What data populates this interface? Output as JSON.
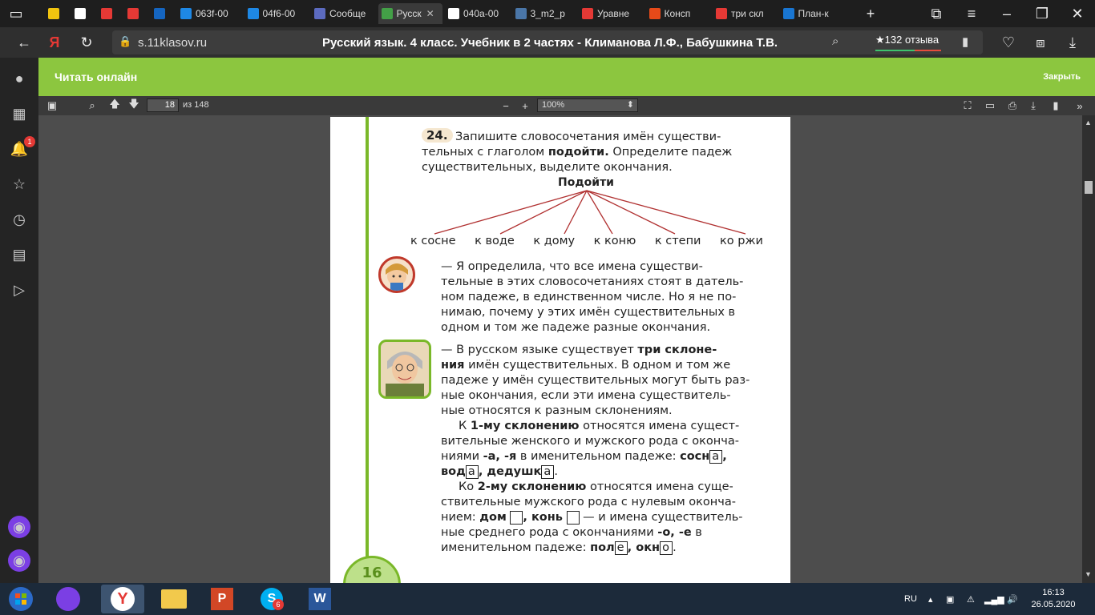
{
  "browser": {
    "tabs": [
      {
        "label": "",
        "color": "#f1c40f",
        "icon": "yellow-i-icon"
      },
      {
        "label": "",
        "color": "#ffffff",
        "icon": "doc-icon"
      },
      {
        "label": "",
        "color": "#e53935",
        "icon": "pdf-icon"
      },
      {
        "label": "",
        "color": "#e53935",
        "icon": "pdf-icon"
      },
      {
        "label": "",
        "color": "#1565c0",
        "icon": "mail-icon"
      },
      {
        "label": "063f-00",
        "color": "#1e88e5",
        "icon": "file-icon"
      },
      {
        "label": "04f6-00",
        "color": "#1e88e5",
        "icon": "file-icon"
      },
      {
        "label": "Сообще",
        "color": "#5c6bc0",
        "icon": "chat-icon"
      },
      {
        "label": "Русск",
        "color": "#43a047",
        "icon": "book-icon"
      },
      {
        "label": "040a-00",
        "color": "#ffffff",
        "icon": "doc-icon"
      },
      {
        "label": "3_m2_p",
        "color": "#4a76a8",
        "icon": "vk-icon"
      },
      {
        "label": "Уравне",
        "color": "#e53935",
        "icon": "yandex-icon"
      },
      {
        "label": "Консп",
        "color": "#e64a19",
        "icon": "briefcase-icon"
      },
      {
        "label": "три скл",
        "color": "#e53935",
        "icon": "yandex-icon"
      },
      {
        "label": "План-к",
        "color": "#1976d2",
        "icon": "check-icon"
      }
    ],
    "url_domain": "s.11klasov.ru",
    "page_title": "Русский язык. 4 класс. Учебник в 2 частях - Климанова Л.Ф., Бабушкина Т.В.",
    "reviews": "★132 отзыва"
  },
  "reader": {
    "title": "Читать онлайн",
    "close": "Закрыть",
    "page_current": "18",
    "page_total": "из 148",
    "zoom": "100%",
    "zoom_minus": "−",
    "zoom_plus": "+"
  },
  "book": {
    "exercise_number": "24.",
    "task_line1": "Запишите словосочетания имён существи-",
    "task_line2a": "тельных с глаголом ",
    "task_line2b": "подойти.",
    "task_line2c": " Определите падеж",
    "task_line3": "существительных, выделите окончания.",
    "verb": "Подойти",
    "words": [
      "к сосне",
      "к воде",
      "к дому",
      "к коню",
      "к степи",
      "ко ржи"
    ],
    "girl_text": [
      "— Я определила, что все имена существи-",
      "тельные в этих словосочетаниях стоят в датель-",
      "ном падеже, в единственном числе. Но я не по-",
      "нимаю, почему у этих имён существительных в",
      "одном и том же падеже разные окончания."
    ],
    "grandpa_l1a": "— В русском языке существует ",
    "grandpa_l1b": "три склоне-",
    "grandpa_l2a": "ния",
    "grandpa_l2b": " имён существительных. В одном и том же",
    "grandpa_l3": "падеже у имён существительных могут быть раз-",
    "grandpa_l4": "ные окончания, если эти имена существитель-",
    "grandpa_l5": "ные относятся к разным склонениям.",
    "decl1_l1a": "К ",
    "decl1_l1b": "1-му склонению",
    "decl1_l1c": " относятся имена сущест-",
    "decl1_l2": "вительные женского и мужского рода с оконча-",
    "decl1_l3a": "ниями ",
    "decl1_l3b": "-а, -я",
    "decl1_l3c": " в именительном падеже: ",
    "w_sosn": "сосн",
    "w_vod": "вод",
    "w_dedushk": "дедушк",
    "end_a": "а",
    "decl2_l1a": "Ко ",
    "decl2_l1b": "2-му склонению",
    "decl2_l1c": " относятся имена суще-",
    "decl2_l2": "ствительные мужского рода с нулевым оконча-",
    "decl2_l3a": "нием: ",
    "w_dom": "дом",
    "w_kon": "конь",
    "decl2_l3b": " — и имена существитель-",
    "decl2_l4a": "ные среднего рода с окончаниями ",
    "decl2_l4b": "-о, -е",
    "decl2_l4c": " в",
    "decl2_l5a": "именительном падеже: ",
    "w_pol": "пол",
    "end_e": "е",
    "w_okn": "окн",
    "end_o": "о",
    "page_number": "16"
  },
  "taskbar": {
    "lang": "RU",
    "time": "16:13",
    "date": "26.05.2020",
    "skype_badge": "6"
  },
  "colors": {
    "accent_green": "#8cc63f",
    "arrow_red": "#b03030"
  }
}
